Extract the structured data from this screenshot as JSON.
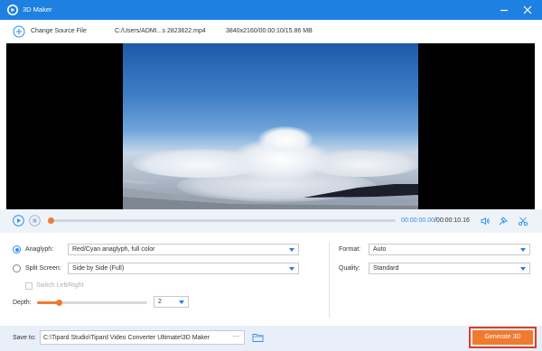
{
  "window": {
    "title": "3D Maker",
    "app_icon": "tipard-app-icon",
    "controls": [
      "minimize-icon",
      "close-icon"
    ]
  },
  "source": {
    "change_label": "Change Source File",
    "file_path": "C:/Users/ADMI...s 2823622.mp4",
    "file_info": "3840x2160/00:00:10/15.86 MB"
  },
  "player": {
    "current_time": "00:00:00.00",
    "total_time": "/00:00:10.16",
    "progress": 0,
    "icons": [
      "play-icon",
      "stop-icon",
      "volume-icon",
      "snapshot-icon",
      "cut-icon"
    ]
  },
  "settings": {
    "anaglyph": {
      "label": "Anaglyph:",
      "selected": true,
      "value": "Red/Cyan anaglyph, full color"
    },
    "split_screen": {
      "label": "Split Screen:",
      "selected": false,
      "value": "Side by Side (Full)"
    },
    "switch_label": "Switch Left/Right",
    "depth": {
      "label": "Depth:",
      "value": "2",
      "level": 0.2
    },
    "format": {
      "label": "Format:",
      "value": "Auto"
    },
    "quality": {
      "label": "Quality:",
      "value": "Standard"
    }
  },
  "output": {
    "save_label": "Save to:",
    "save_path": "C:\\Tipard Studio\\Tipard Video Converter Ultimate\\3D Maker",
    "browse_label": "···",
    "generate_label": "Generate 3D"
  },
  "colors": {
    "titlebar": "#1e80e0",
    "accent": "#2e8fe8",
    "orange": "#f07a2e",
    "highlight": "#e23b26"
  }
}
